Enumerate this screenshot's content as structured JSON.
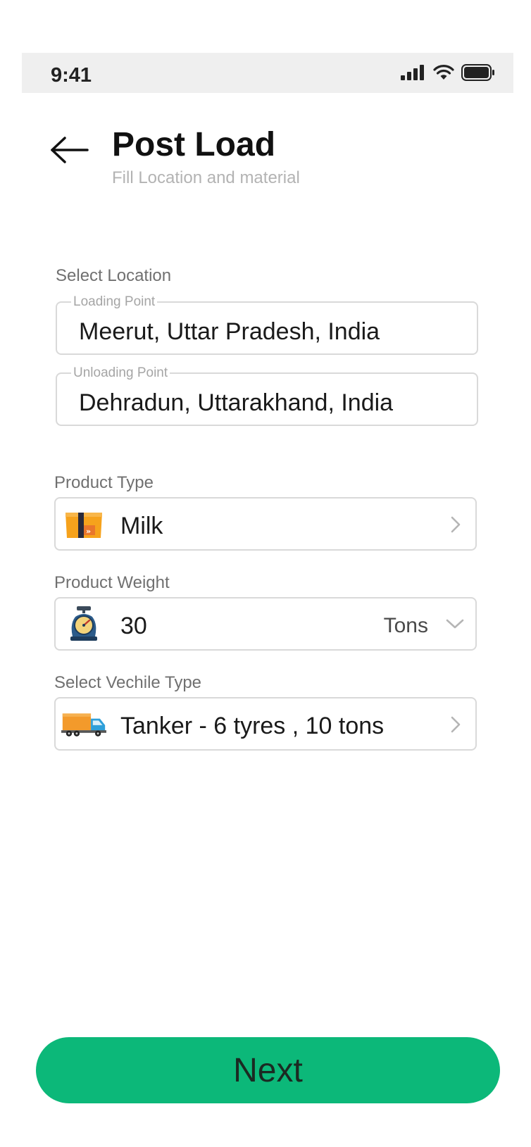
{
  "status_bar": {
    "time": "9:41",
    "icons": [
      "signal-icon",
      "wifi-icon",
      "battery-icon"
    ]
  },
  "header": {
    "back_icon": "arrow-left-icon",
    "title": "Post Load",
    "subtitle": "Fill Location and material"
  },
  "location": {
    "section_label": "Select Location",
    "loading_point": {
      "legend": "Loading Point",
      "value": "Meerut, Uttar Pradesh, India"
    },
    "unloading_point": {
      "legend": "Unloading Point",
      "value": "Dehradun, Uttarakhand, India"
    }
  },
  "product_type": {
    "label": "Product Type",
    "icon": "package-box-icon",
    "value": "Milk",
    "chevron": "chevron-right-icon"
  },
  "product_weight": {
    "label": "Product Weight",
    "icon": "weighing-scale-icon",
    "value": "30",
    "unit": "Tons",
    "chevron": "chevron-down-icon"
  },
  "vehicle_type": {
    "label": "Select Vechile Type",
    "icon": "truck-icon",
    "value": "Tanker - 6 tyres , 10 tons",
    "chevron": "chevron-right-icon"
  },
  "footer": {
    "next_label": "Next"
  },
  "colors": {
    "accent": "#0cb879",
    "status_bar_bg": "#efefef",
    "field_border": "#d9d9d9",
    "label_text": "#707070",
    "subtitle_text": "#b3b3b3"
  }
}
